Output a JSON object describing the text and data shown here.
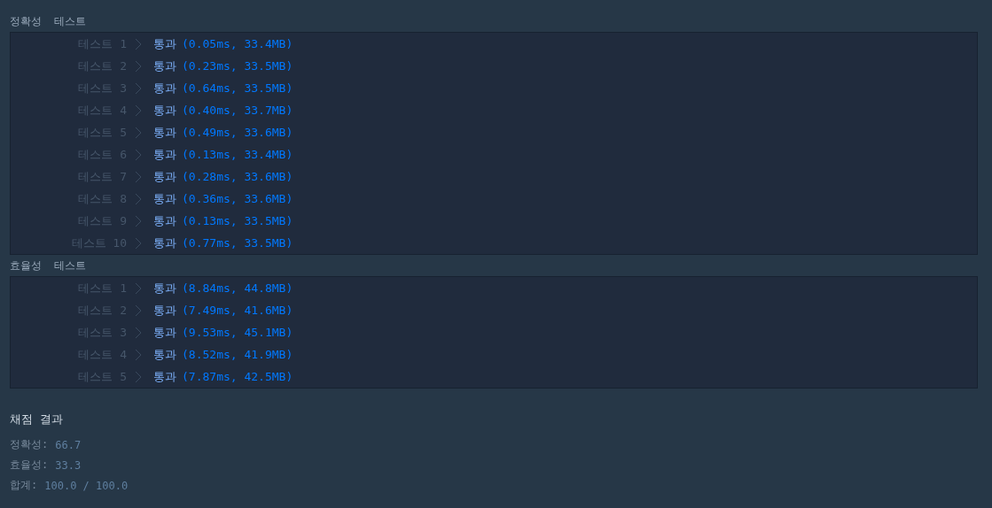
{
  "sections": [
    {
      "title": "정확성  테스트",
      "tests": [
        {
          "label": "테스트 1",
          "status": "통과",
          "detail": "(0.05ms, 33.4MB)"
        },
        {
          "label": "테스트 2",
          "status": "통과",
          "detail": "(0.23ms, 33.5MB)"
        },
        {
          "label": "테스트 3",
          "status": "통과",
          "detail": "(0.64ms, 33.5MB)"
        },
        {
          "label": "테스트 4",
          "status": "통과",
          "detail": "(0.40ms, 33.7MB)"
        },
        {
          "label": "테스트 5",
          "status": "통과",
          "detail": "(0.49ms, 33.6MB)"
        },
        {
          "label": "테스트 6",
          "status": "통과",
          "detail": "(0.13ms, 33.4MB)"
        },
        {
          "label": "테스트 7",
          "status": "통과",
          "detail": "(0.28ms, 33.6MB)"
        },
        {
          "label": "테스트 8",
          "status": "통과",
          "detail": "(0.36ms, 33.6MB)"
        },
        {
          "label": "테스트 9",
          "status": "통과",
          "detail": "(0.13ms, 33.5MB)"
        },
        {
          "label": "테스트 10",
          "status": "통과",
          "detail": "(0.77ms, 33.5MB)"
        }
      ]
    },
    {
      "title": "효율성  테스트",
      "tests": [
        {
          "label": "테스트 1",
          "status": "통과",
          "detail": "(8.84ms, 44.8MB)"
        },
        {
          "label": "테스트 2",
          "status": "통과",
          "detail": "(7.49ms, 41.6MB)"
        },
        {
          "label": "테스트 3",
          "status": "통과",
          "detail": "(9.53ms, 45.1MB)"
        },
        {
          "label": "테스트 4",
          "status": "통과",
          "detail": "(8.52ms, 41.9MB)"
        },
        {
          "label": "테스트 5",
          "status": "통과",
          "detail": "(7.87ms, 42.5MB)"
        }
      ]
    }
  ],
  "result": {
    "title": "채점 결과",
    "scores": [
      {
        "label": "정확성:",
        "value": "66.7"
      },
      {
        "label": "효율성:",
        "value": "33.3"
      },
      {
        "label": "합계:",
        "value": "100.0 / 100.0"
      }
    ]
  }
}
